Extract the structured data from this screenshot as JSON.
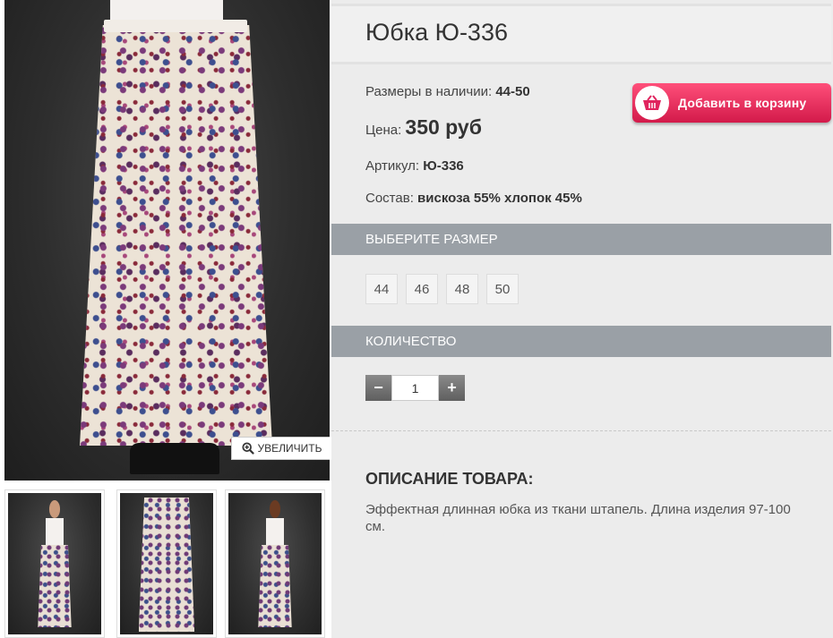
{
  "product": {
    "title": "Юбка Ю-336",
    "sizes_available_label": "Размеры в наличии:",
    "sizes_available_value": "44-50",
    "price_label": "Цена:",
    "price_value": "350 руб",
    "sku_label": "Артикул:",
    "sku_value": "Ю-336",
    "composition_label": "Состав:",
    "composition_value": "вискоза 55% хлопок 45%"
  },
  "cart": {
    "add_label": "Добавить в корзину"
  },
  "size_section": {
    "title": "ВЫБЕРИТЕ РАЗМЕР",
    "options": [
      "44",
      "46",
      "48",
      "50"
    ]
  },
  "quantity_section": {
    "title": "КОЛИЧЕСТВО",
    "value": "1",
    "minus": "−",
    "plus": "+"
  },
  "gallery": {
    "zoom_label": "УВЕЛИЧИТЬ"
  },
  "description": {
    "title": "ОПИСАНИЕ ТОВАРА:",
    "text": "Эффектная длинная юбка из ткани штапель. Длина изделия 97-100 см."
  },
  "colors": {
    "accent": "#e0245e",
    "section_bar": "#9aa0a6",
    "qty_button": "#6e6e6e"
  },
  "icons": {
    "zoom": "magnifier-plus-icon",
    "cart": "basket-icon"
  }
}
